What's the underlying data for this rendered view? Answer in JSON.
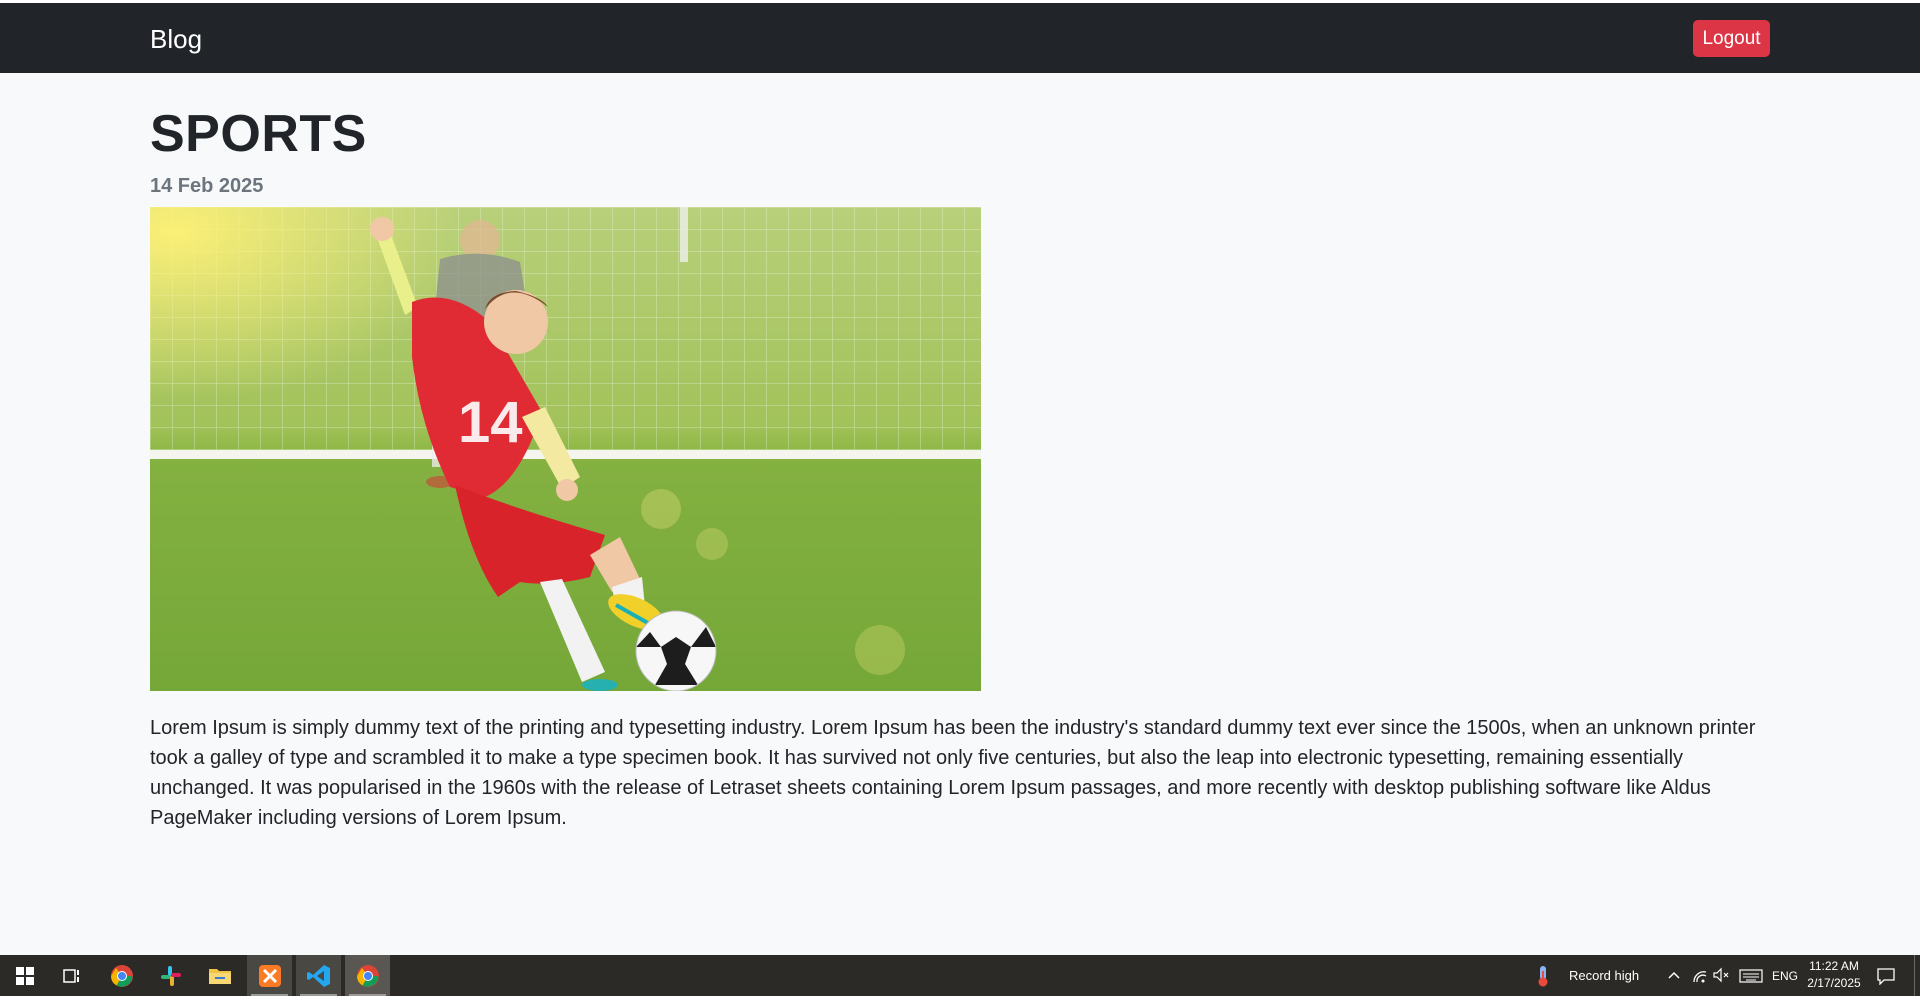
{
  "navbar": {
    "brand": "Blog",
    "logout_label": "Logout"
  },
  "post": {
    "title": "SPORTS",
    "date": "14 Feb 2025",
    "image_alt": "boy in red jersey number 14 kicking a soccer ball towards goal",
    "jersey_number": "14",
    "body": "Lorem Ipsum is simply dummy text of the printing and typesetting industry. Lorem Ipsum has been the industry's standard dummy text ever since the 1500s, when an unknown printer took a galley of type and scrambled it to make a type specimen book. It has survived not only five centuries, but also the leap into electronic typesetting, remaining essentially unchanged. It was popularised in the 1960s with the release of Letraset sheets containing Lorem Ipsum passages, and more recently with desktop publishing software like Aldus PageMaker including versions of Lorem Ipsum."
  },
  "taskbar": {
    "apps": [
      {
        "name": "start-icon"
      },
      {
        "name": "task-view-icon"
      },
      {
        "name": "chrome-icon"
      },
      {
        "name": "slack-icon"
      },
      {
        "name": "file-explorer-icon"
      },
      {
        "name": "xampp-icon"
      },
      {
        "name": "vscode-icon"
      },
      {
        "name": "chrome-active-icon"
      }
    ],
    "weather": "Record high",
    "language": "ENG",
    "time": "11:22 AM",
    "date": "2/17/2025"
  },
  "colors": {
    "navbar_bg": "#212529",
    "logout_bg": "#dc3545",
    "page_bg": "#f8f9fa",
    "taskbar_bg": "#2c2a26"
  }
}
